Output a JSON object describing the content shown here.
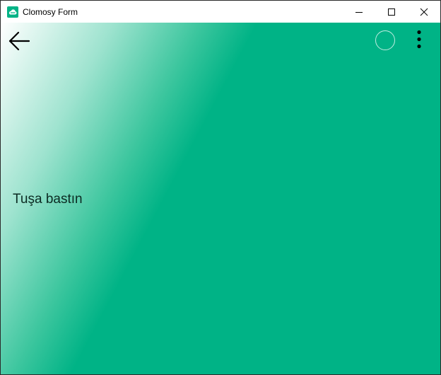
{
  "window": {
    "title": "Clomosy Form",
    "icon": "clomosy-app-icon",
    "controls": {
      "minimize": "minimize-icon",
      "maximize": "maximize-icon",
      "close": "close-icon"
    }
  },
  "toolbar": {
    "back_icon": "arrow-left-icon",
    "circle_icon": "circle-outline-icon",
    "menu_icon": "more-vertical-icon"
  },
  "main": {
    "message": "Tuşa bastın"
  },
  "colors": {
    "accent": "#00b386",
    "gradient_start": "#ffffff",
    "title_bar": "#ffffff"
  }
}
